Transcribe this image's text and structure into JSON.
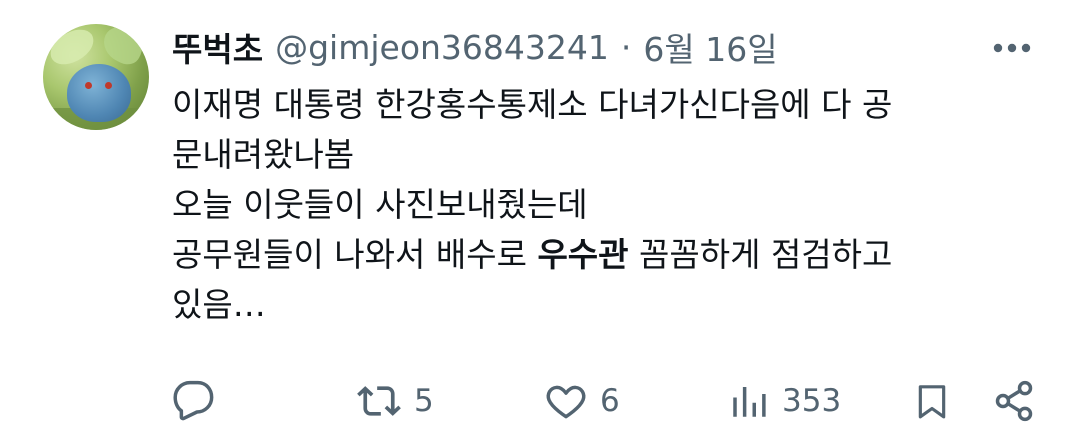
{
  "user": {
    "display_name": "뚜벅초",
    "handle": "@gimjeon36843241",
    "separator": "·",
    "date": "6월 16일"
  },
  "tweet": {
    "line1": "이재명 대통령 한강홍수통제소 다녀가신다음에 다 공",
    "line2": "문내려왔나봄",
    "line3": "오늘 이웃들이 사진보내줬는데",
    "line4_before": "공무원들이 나와서 배수로 ",
    "line4_bold": "우수관",
    "line4_after": " 꼼꼼하게 점검하고",
    "line5": "있음…"
  },
  "actions": {
    "reply_icon": "reply-icon",
    "retweet_icon": "retweet-icon",
    "retweet_count": "5",
    "like_icon": "heart-icon",
    "like_count": "6",
    "views_icon": "views-icon",
    "views_count": "353",
    "bookmark_icon": "bookmark-icon",
    "share_icon": "share-icon"
  },
  "colors": {
    "text_primary": "#0f1419",
    "text_secondary": "#536471",
    "background": "#ffffff"
  }
}
